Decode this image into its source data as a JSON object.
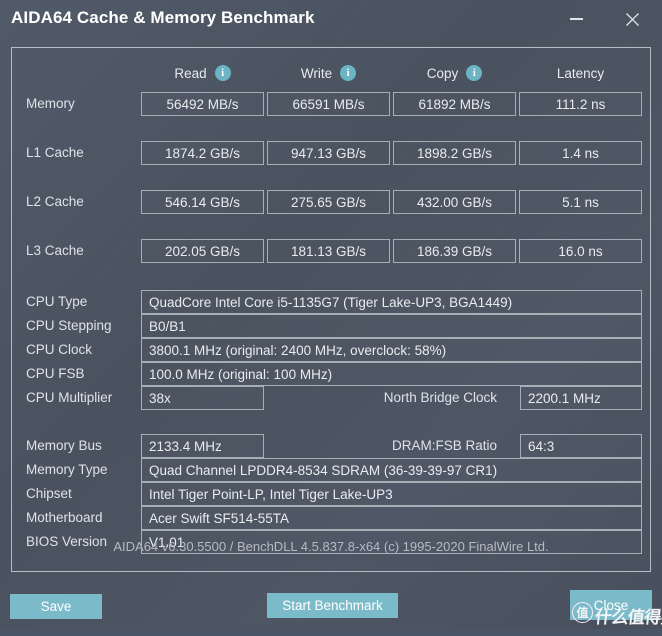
{
  "window": {
    "title": "AIDA64 Cache & Memory Benchmark",
    "minimize_label": "Minimize",
    "close_label": "Close"
  },
  "benchmark": {
    "columns": [
      {
        "label": "Read",
        "info": "i"
      },
      {
        "label": "Write",
        "info": "i"
      },
      {
        "label": "Copy",
        "info": "i"
      },
      {
        "label": "Latency",
        "info": ""
      }
    ],
    "rows": [
      {
        "label": "Memory",
        "read": "56492 MB/s",
        "write": "66591 MB/s",
        "copy": "61892 MB/s",
        "latency": "111.2 ns"
      },
      {
        "label": "L1 Cache",
        "read": "1874.2 GB/s",
        "write": "947.13 GB/s",
        "copy": "1898.2 GB/s",
        "latency": "1.4 ns"
      },
      {
        "label": "L2 Cache",
        "read": "546.14 GB/s",
        "write": "275.65 GB/s",
        "copy": "432.00 GB/s",
        "latency": "5.1 ns"
      },
      {
        "label": "L3 Cache",
        "read": "202.05 GB/s",
        "write": "181.13 GB/s",
        "copy": "186.39 GB/s",
        "latency": "16.0 ns"
      }
    ]
  },
  "cpu_info": {
    "cpu_type_label": "CPU Type",
    "cpu_type_value": "QuadCore Intel Core i5-1135G7  (Tiger Lake-UP3, BGA1449)",
    "cpu_stepping_label": "CPU Stepping",
    "cpu_stepping_value": "B0/B1",
    "cpu_clock_label": "CPU Clock",
    "cpu_clock_value": "3800.1 MHz  (original: 2400 MHz, overclock: 58%)",
    "cpu_fsb_label": "CPU FSB",
    "cpu_fsb_value": "100.0 MHz  (original: 100 MHz)",
    "cpu_multiplier_label": "CPU Multiplier",
    "cpu_multiplier_value": "38x",
    "north_bridge_label": "North Bridge Clock",
    "north_bridge_value": "2200.1 MHz"
  },
  "system_info": {
    "memory_bus_label": "Memory Bus",
    "memory_bus_value": "2133.4 MHz",
    "dram_fsb_label": "DRAM:FSB Ratio",
    "dram_fsb_value": "64:3",
    "memory_type_label": "Memory Type",
    "memory_type_value": "Quad Channel LPDDR4-8534 SDRAM  (36-39-39-97 CR1)",
    "chipset_label": "Chipset",
    "chipset_value": "Intel Tiger Point-LP, Intel Tiger Lake-UP3",
    "motherboard_label": "Motherboard",
    "motherboard_value": "Acer Swift SF514-55TA",
    "bios_label": "BIOS Version",
    "bios_value": "V1.01"
  },
  "credit": "AIDA64 v6.30.5500 / BenchDLL 4.5.837.8-x64  (c) 1995-2020 FinalWire Ltd.",
  "buttons": {
    "save": "Save",
    "start_benchmark": "Start Benchmark",
    "close": "Close"
  },
  "watermark": {
    "logo": "值",
    "text": "什么值得买"
  },
  "colors": {
    "background": "#4e5665",
    "accent": "#7bbac9",
    "info_icon": "#6cb3c4",
    "border": "#a9adb6",
    "text": "#e9ebef"
  }
}
